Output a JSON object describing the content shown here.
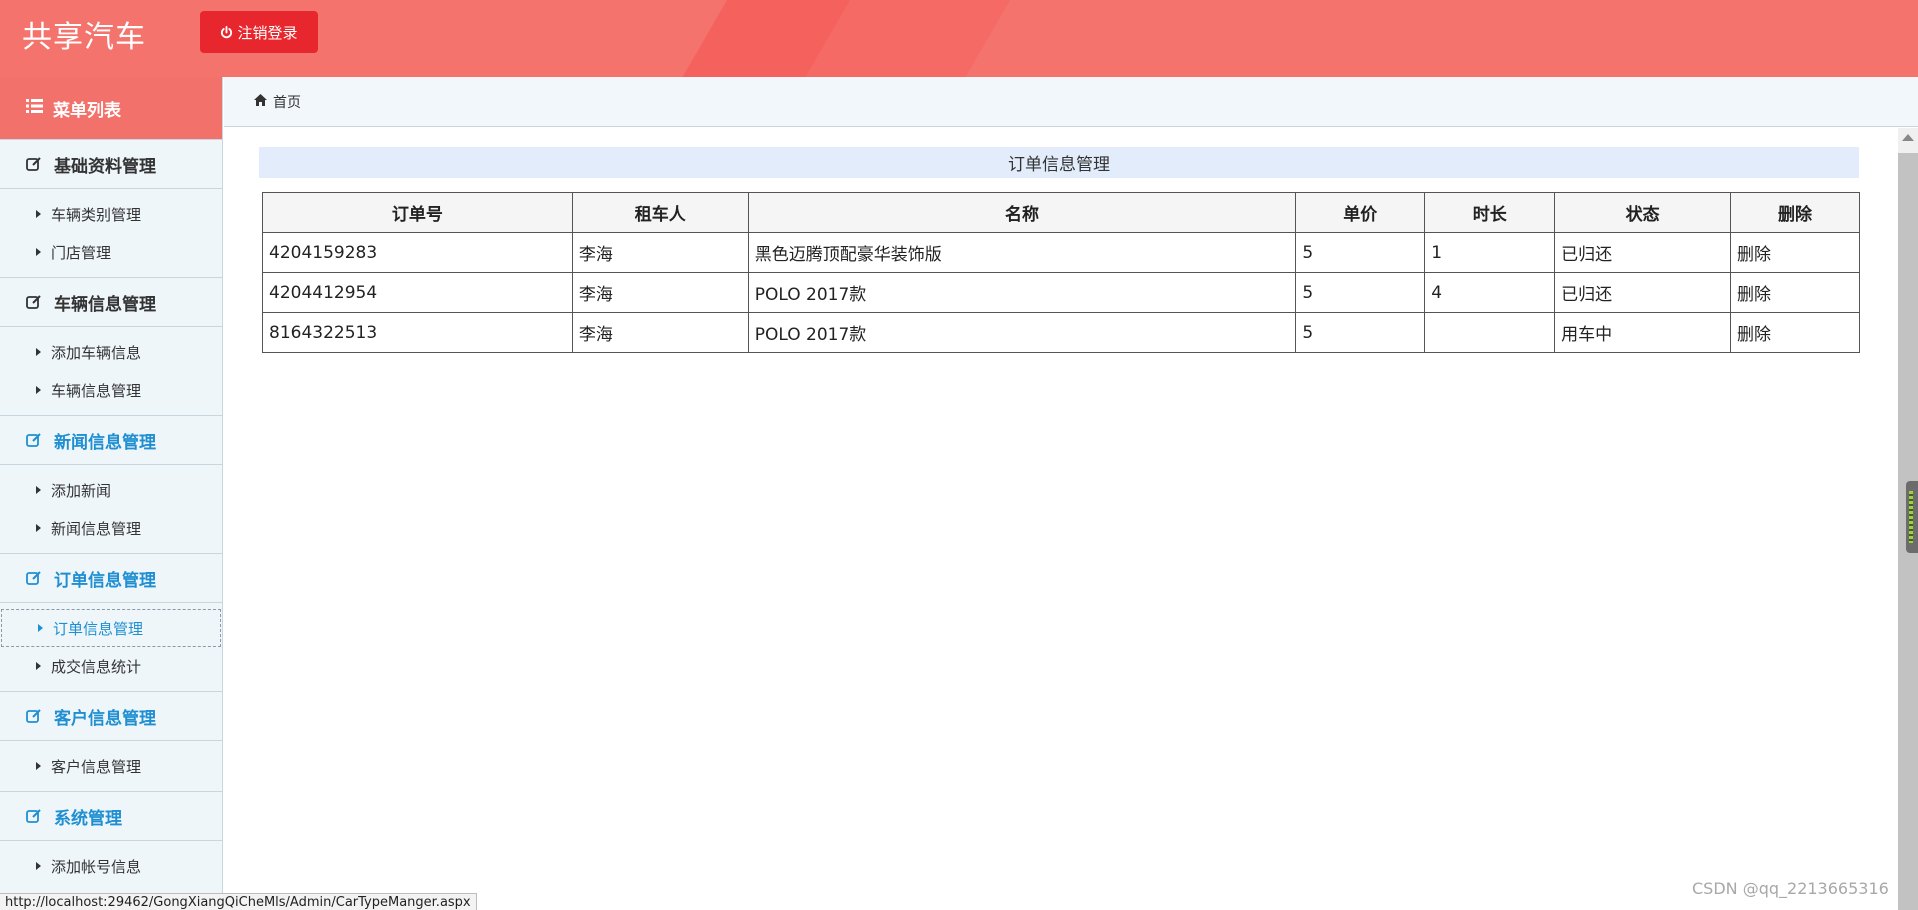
{
  "app": {
    "title": "共享汽车",
    "logout_label": "注销登录"
  },
  "sidebar": {
    "menu_title": "菜单列表",
    "groups": [
      {
        "label": "基础资料管理",
        "items": [
          "车辆类别管理",
          "门店管理"
        ]
      },
      {
        "label": "车辆信息管理",
        "items": [
          "添加车辆信息",
          "车辆信息管理"
        ]
      },
      {
        "label": "新闻信息管理",
        "items": [
          "添加新闻",
          "新闻信息管理"
        ]
      },
      {
        "label": "订单信息管理",
        "items": [
          "订单信息管理",
          "成交信息统计"
        ]
      },
      {
        "label": "客户信息管理",
        "items": [
          "客户信息管理"
        ]
      },
      {
        "label": "系统管理",
        "items": [
          "添加帐号信息"
        ]
      }
    ],
    "active_item": "订单信息管理"
  },
  "breadcrumb": {
    "home_label": "首页"
  },
  "panel": {
    "title": "订单信息管理"
  },
  "table": {
    "headers": [
      "订单号",
      "租车人",
      "名称",
      "单价",
      "时长",
      "状态",
      "删除"
    ],
    "rows": [
      [
        "4204159283",
        "李海",
        "黑色迈腾顶配豪华装饰版",
        "5",
        "1",
        "已归还",
        "删除"
      ],
      [
        "4204412954",
        "李海",
        "POLO 2017款",
        "5",
        "4",
        "已归还",
        "删除"
      ],
      [
        "8164322513",
        "李海",
        "POLO 2017款",
        "5",
        "",
        "用车中",
        "删除"
      ]
    ]
  },
  "status_bar": {
    "url": "http://localhost:29462/GongXiangQiCheMls/Admin/CarTypeManger.aspx"
  },
  "watermark": "CSDN @qq_2213665316",
  "colors": {
    "header": "#f4736d",
    "logout_button": "#e8262d",
    "active_link": "#1f8fd1",
    "panel_title_bg": "#e2ecfb"
  }
}
